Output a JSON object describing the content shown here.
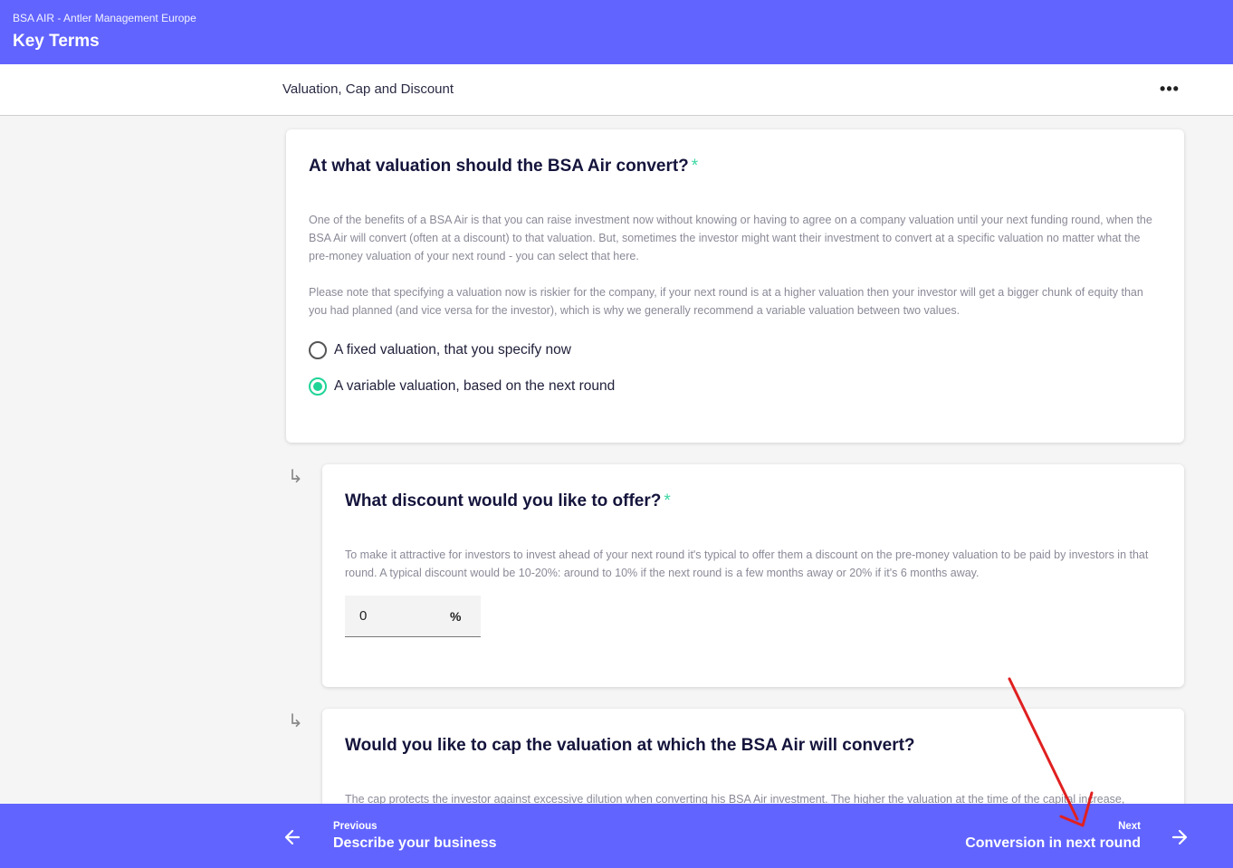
{
  "topbar": {
    "org": "BSA AIR - Antler Management Europe",
    "title": "Key Terms"
  },
  "subheader": {
    "section": "Valuation, Cap and Discount",
    "more_icon": "ellipsis-horizontal"
  },
  "q1": {
    "title": "At what valuation should the BSA Air convert?",
    "required": "*",
    "para1": "One of the benefits of a BSA Air is that you can raise investment now without knowing or having to agree on a company valuation until your next funding round, when the BSA Air will convert (often at a discount) to that valuation. But, sometimes the investor might want their investment to convert at a specific valuation no matter what the pre-money valuation of your next round - you can select that here.",
    "para2": "Please note that specifying a valuation now is riskier for the company, if your next round is at a higher valuation then your investor will get a bigger chunk of equity than you had planned (and vice versa for the investor), which is why we generally recommend a variable valuation between two values.",
    "options": [
      {
        "label": "A fixed valuation, that you specify now",
        "selected": false
      },
      {
        "label": "A variable valuation, based on the next round",
        "selected": true
      }
    ]
  },
  "q2": {
    "title": "What discount would you like to offer?",
    "required": "*",
    "para1": "To make it attractive for investors to invest ahead of your next round it's typical to offer them a discount on the pre-money valuation to be paid by investors in that round. A typical discount would be 10-20%: around to 10% if the next round is a few months away or 20% if it's 6 months away.",
    "value": "0",
    "unit": "%"
  },
  "q3": {
    "title": "Would you like to cap the valuation at which the BSA Air will convert?",
    "para1": "The cap protects the investor against excessive dilution when converting his BSA Air investment. The higher the valuation at the time of the capital increase,"
  },
  "subquestion_icon": "↳",
  "bottombar": {
    "prev_small": "Previous",
    "prev_big": "Describe your business",
    "next_small": "Next",
    "next_big": "Conversion in next round"
  },
  "colors": {
    "brand": "#6164ff",
    "accent": "#20d497",
    "annotation": "#e02020"
  }
}
